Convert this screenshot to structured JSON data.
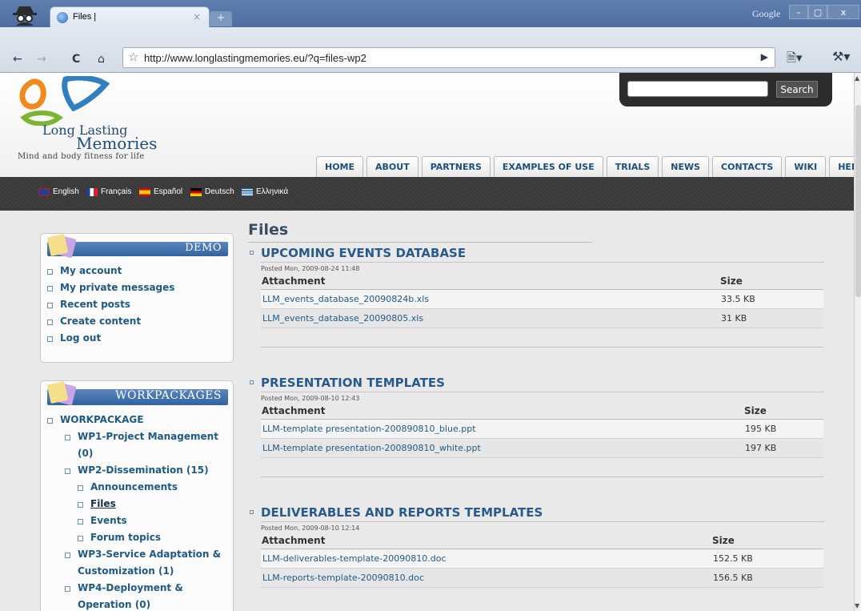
{
  "browser": {
    "tab_title": "Files |",
    "tab_close": "×",
    "new_tab": "+",
    "brand": "Google",
    "url": "http://www.longlastingmemories.eu/?q=files-wp2",
    "buttons": {
      "minimize": "–",
      "maximize": "▢",
      "close": "x"
    }
  },
  "site": {
    "logo_line1": "Long Lasting",
    "logo_line2": "Memories",
    "tagline": "Mind and body fitness for life",
    "search_button": "Search",
    "search_value": "",
    "menu": [
      "HOME",
      "ABOUT",
      "PARTNERS",
      "EXAMPLES OF USE",
      "TRIALS",
      "NEWS",
      "CONTACTS",
      "WIKI",
      "HELP"
    ],
    "languages": [
      "English",
      "Français",
      "Español",
      "Deutsch",
      "Ελληνικά"
    ]
  },
  "sidebar": {
    "demo": {
      "title": "DEMO",
      "items": [
        "My account",
        "My private messages",
        "Recent posts",
        "Create content",
        "Log out"
      ]
    },
    "workpackages": {
      "title": "WORKPACKAGES",
      "items": [
        "WORKPACKAGE",
        "WP1-Project Management",
        "(0)",
        "WP2-Dissemination (15)",
        "Announcements",
        "Files",
        "Events",
        "Forum topics",
        "WP3-Service Adaptation &",
        "Customization (1)",
        "WP4-Deployment &",
        "Operation (0)"
      ]
    }
  },
  "main": {
    "title": "Files",
    "nodes": [
      {
        "title": "UPCOMING EVENTS DATABASE",
        "posted": "Posted Mon, 2009-08-24 11:48",
        "col_attachment": "Attachment",
        "col_size": "Size",
        "files": [
          {
            "name": "LLM_events_database_20090824b.xls",
            "size": "33.5 KB"
          },
          {
            "name": "LLM_events_database_20090805.xls",
            "size": "31 KB"
          }
        ]
      },
      {
        "title": "PRESENTATION TEMPLATES",
        "posted": "Posted Mon, 2009-08-10 12:43",
        "col_attachment": "Attachment",
        "col_size": "Size",
        "files": [
          {
            "name": "LLM-template presentation-200890810_blue.ppt",
            "size": "195 KB"
          },
          {
            "name": "LLM-template presentation-200890810_white.ppt",
            "size": "197 KB"
          }
        ]
      },
      {
        "title": "DELIVERABLES AND REPORTS TEMPLATES",
        "posted": "Posted Mon, 2009-08-10 12:14",
        "col_attachment": "Attachment",
        "col_size": "Size",
        "files": [
          {
            "name": "LLM-deliverables-template-20090810.doc",
            "size": "152.5 KB"
          },
          {
            "name": "LLM-reports-template-20090810.doc",
            "size": "156.5 KB"
          }
        ]
      }
    ]
  }
}
